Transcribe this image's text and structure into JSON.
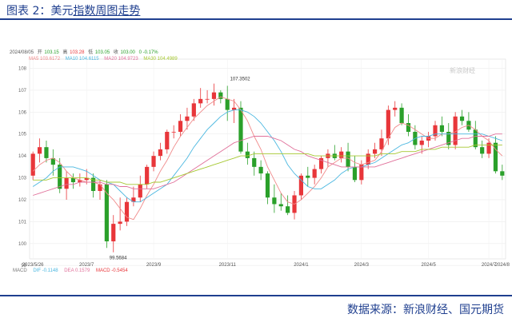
{
  "caption": {
    "prefix": "图表 2：美元",
    "underlined": "指数周图走势"
  },
  "source": "数据来源：新浪财经、国元期货",
  "info_line": {
    "date": "2024/08/05",
    "open_label": "开",
    "open": "103.15",
    "high_label": "高",
    "high": "103.28",
    "low_label": "低",
    "low": "103.05",
    "close_label": "收",
    "close": "103.00",
    "change": "0 -0.17%"
  },
  "ma_line": {
    "ma5": "MA5 103.6172",
    "ma10": "MA10 104.6115",
    "ma20": "MA20 104.9723",
    "ma30": "MA30 104.4989"
  },
  "macd_line": {
    "label": "MACD",
    "dif": "DIF -0.1148",
    "dea": "DEA 0.1579",
    "macd": "MACD -0.5454"
  },
  "watermark": "新浪财经",
  "colors": {
    "up": "#e8363a",
    "down": "#2aa02a",
    "ma5": "#f08a8a",
    "ma10": "#4ab7e0",
    "ma20": "#e0709a",
    "ma30": "#a6c832",
    "title": "#1f3f8f"
  },
  "chart_data": {
    "type": "candlestick",
    "title": "美元指数周图走势",
    "ylim": [
      99.3,
      108.2
    ],
    "y_ticks": [
      "108",
      "107",
      "106",
      "105",
      "104",
      "103",
      "102",
      "101",
      "100",
      "99"
    ],
    "x_ticks": [
      "2023/5/26",
      "2023/7",
      "2023/9",
      "2023/11",
      "2024/1",
      "2024/3",
      "2024/5",
      "2024/7",
      "2024/8"
    ],
    "annotations": [
      {
        "text": "107.3502",
        "value": 107.35,
        "candle": 30
      },
      {
        "text": "99.5684",
        "value": 99.57,
        "candle": 12
      }
    ],
    "candles": [
      {
        "o": 103.1,
        "h": 104.2,
        "l": 102.9,
        "c": 104.1
      },
      {
        "o": 104.1,
        "h": 104.8,
        "l": 103.7,
        "c": 104.4
      },
      {
        "o": 104.4,
        "h": 104.7,
        "l": 103.7,
        "c": 103.9
      },
      {
        "o": 103.9,
        "h": 104.3,
        "l": 103.1,
        "c": 103.6
      },
      {
        "o": 103.6,
        "h": 103.9,
        "l": 102.3,
        "c": 102.5
      },
      {
        "o": 102.5,
        "h": 103.3,
        "l": 102.0,
        "c": 103.0
      },
      {
        "o": 103.0,
        "h": 103.2,
        "l": 102.5,
        "c": 102.8
      },
      {
        "o": 102.8,
        "h": 103.2,
        "l": 102.6,
        "c": 102.9
      },
      {
        "o": 102.9,
        "h": 103.4,
        "l": 102.7,
        "c": 103.0
      },
      {
        "o": 103.0,
        "h": 103.2,
        "l": 102.1,
        "c": 102.4
      },
      {
        "o": 102.4,
        "h": 102.9,
        "l": 102.0,
        "c": 102.7
      },
      {
        "o": 102.7,
        "h": 102.9,
        "l": 99.8,
        "c": 100.1
      },
      {
        "o": 100.1,
        "h": 101.3,
        "l": 99.6,
        "c": 100.9
      },
      {
        "o": 100.9,
        "h": 102.1,
        "l": 100.6,
        "c": 101.0
      },
      {
        "o": 101.0,
        "h": 102.1,
        "l": 100.8,
        "c": 101.9
      },
      {
        "o": 101.9,
        "h": 102.6,
        "l": 101.7,
        "c": 102.1
      },
      {
        "o": 102.1,
        "h": 103.1,
        "l": 101.9,
        "c": 102.7
      },
      {
        "o": 102.7,
        "h": 103.6,
        "l": 102.5,
        "c": 103.5
      },
      {
        "o": 103.5,
        "h": 104.2,
        "l": 103.3,
        "c": 104.0
      },
      {
        "o": 104.0,
        "h": 104.6,
        "l": 103.8,
        "c": 104.3
      },
      {
        "o": 104.3,
        "h": 105.2,
        "l": 104.1,
        "c": 105.1
      },
      {
        "o": 105.1,
        "h": 105.4,
        "l": 104.8,
        "c": 105.1
      },
      {
        "o": 105.1,
        "h": 105.9,
        "l": 104.9,
        "c": 105.6
      },
      {
        "o": 105.6,
        "h": 106.2,
        "l": 105.2,
        "c": 105.8
      },
      {
        "o": 105.8,
        "h": 106.6,
        "l": 105.6,
        "c": 106.4
      },
      {
        "o": 106.4,
        "h": 107.1,
        "l": 106.2,
        "c": 106.6
      },
      {
        "o": 106.6,
        "h": 107.0,
        "l": 106.4,
        "c": 106.6
      },
      {
        "o": 106.6,
        "h": 107.3,
        "l": 106.3,
        "c": 106.9
      },
      {
        "o": 106.9,
        "h": 107.0,
        "l": 106.4,
        "c": 106.6
      },
      {
        "o": 106.6,
        "h": 107.2,
        "l": 105.6,
        "c": 106.1
      },
      {
        "o": 106.1,
        "h": 106.6,
        "l": 105.5,
        "c": 106.2
      },
      {
        "o": 106.2,
        "h": 106.5,
        "l": 104.1,
        "c": 104.2
      },
      {
        "o": 104.2,
        "h": 104.6,
        "l": 103.6,
        "c": 103.9
      },
      {
        "o": 103.9,
        "h": 104.2,
        "l": 103.1,
        "c": 103.5
      },
      {
        "o": 103.5,
        "h": 103.8,
        "l": 102.9,
        "c": 103.2
      },
      {
        "o": 103.2,
        "h": 103.3,
        "l": 101.8,
        "c": 102.1
      },
      {
        "o": 102.1,
        "h": 102.7,
        "l": 101.4,
        "c": 101.8
      },
      {
        "o": 101.8,
        "h": 102.3,
        "l": 101.5,
        "c": 101.7
      },
      {
        "o": 101.7,
        "h": 102.2,
        "l": 101.3,
        "c": 101.4
      },
      {
        "o": 101.4,
        "h": 102.4,
        "l": 101.1,
        "c": 102.2
      },
      {
        "o": 102.2,
        "h": 103.2,
        "l": 102.0,
        "c": 103.1
      },
      {
        "o": 103.1,
        "h": 103.5,
        "l": 102.6,
        "c": 103.0
      },
      {
        "o": 103.0,
        "h": 103.6,
        "l": 102.7,
        "c": 103.4
      },
      {
        "o": 103.4,
        "h": 104.0,
        "l": 103.2,
        "c": 103.9
      },
      {
        "o": 103.9,
        "h": 104.3,
        "l": 103.5,
        "c": 104.1
      },
      {
        "o": 104.1,
        "h": 104.5,
        "l": 103.8,
        "c": 103.9
      },
      {
        "o": 103.9,
        "h": 104.4,
        "l": 103.7,
        "c": 104.2
      },
      {
        "o": 104.2,
        "h": 104.6,
        "l": 103.3,
        "c": 103.5
      },
      {
        "o": 103.5,
        "h": 104.0,
        "l": 102.8,
        "c": 102.9
      },
      {
        "o": 102.9,
        "h": 103.8,
        "l": 102.7,
        "c": 103.6
      },
      {
        "o": 103.6,
        "h": 104.3,
        "l": 103.4,
        "c": 104.1
      },
      {
        "o": 104.1,
        "h": 104.6,
        "l": 103.9,
        "c": 104.3
      },
      {
        "o": 104.3,
        "h": 105.2,
        "l": 104.0,
        "c": 104.8
      },
      {
        "o": 104.8,
        "h": 106.3,
        "l": 104.5,
        "c": 106.1
      },
      {
        "o": 106.1,
        "h": 106.5,
        "l": 105.8,
        "c": 106.2
      },
      {
        "o": 106.2,
        "h": 106.4,
        "l": 105.4,
        "c": 105.5
      },
      {
        "o": 105.5,
        "h": 105.9,
        "l": 104.9,
        "c": 105.1
      },
      {
        "o": 105.1,
        "h": 105.4,
        "l": 104.3,
        "c": 104.5
      },
      {
        "o": 104.5,
        "h": 104.9,
        "l": 104.1,
        "c": 104.7
      },
      {
        "o": 104.7,
        "h": 105.1,
        "l": 104.4,
        "c": 104.9
      },
      {
        "o": 104.9,
        "h": 105.6,
        "l": 104.7,
        "c": 105.4
      },
      {
        "o": 105.4,
        "h": 105.8,
        "l": 104.9,
        "c": 105.1
      },
      {
        "o": 105.1,
        "h": 105.5,
        "l": 104.3,
        "c": 104.5
      },
      {
        "o": 104.5,
        "h": 106.0,
        "l": 104.3,
        "c": 105.8
      },
      {
        "o": 105.8,
        "h": 106.1,
        "l": 105.4,
        "c": 105.6
      },
      {
        "o": 105.6,
        "h": 106.0,
        "l": 105.1,
        "c": 105.2
      },
      {
        "o": 105.2,
        "h": 105.6,
        "l": 104.3,
        "c": 104.4
      },
      {
        "o": 104.4,
        "h": 104.7,
        "l": 103.9,
        "c": 104.1
      },
      {
        "o": 104.1,
        "h": 104.8,
        "l": 103.9,
        "c": 104.6
      },
      {
        "o": 104.6,
        "h": 104.9,
        "l": 103.2,
        "c": 103.3
      },
      {
        "o": 103.3,
        "h": 103.6,
        "l": 102.9,
        "c": 103.1
      }
    ],
    "series": [
      {
        "name": "MA5",
        "values": [
          103.3,
          103.6,
          103.8,
          103.9,
          103.7,
          103.3,
          103.0,
          102.9,
          102.8,
          102.8,
          102.7,
          102.3,
          102.0,
          101.6,
          101.2,
          101.1,
          101.6,
          102.2,
          102.7,
          103.3,
          103.8,
          104.4,
          104.9,
          105.3,
          105.7,
          106.0,
          106.3,
          106.5,
          106.7,
          106.6,
          106.5,
          106.1,
          105.6,
          104.9,
          104.3,
          103.5,
          102.9,
          102.3,
          101.9,
          101.8,
          102.0,
          102.3,
          102.6,
          103.0,
          103.5,
          103.7,
          103.9,
          103.9,
          103.7,
          103.6,
          103.7,
          103.8,
          104.2,
          104.8,
          105.3,
          105.5,
          105.4,
          105.2,
          105.0,
          104.8,
          104.8,
          105.0,
          105.0,
          105.1,
          105.3,
          105.4,
          105.2,
          104.9,
          104.7,
          104.3,
          104.0
        ]
      },
      {
        "name": "MA10",
        "values": [
          102.6,
          102.8,
          103.0,
          103.3,
          103.5,
          103.5,
          103.5,
          103.4,
          103.3,
          103.1,
          102.9,
          102.8,
          102.7,
          102.4,
          102.1,
          101.9,
          101.9,
          102.1,
          102.3,
          102.5,
          102.7,
          103.1,
          103.5,
          103.9,
          104.4,
          104.8,
          105.2,
          105.5,
          105.8,
          106.0,
          106.1,
          106.1,
          106.0,
          105.8,
          105.5,
          105.1,
          104.7,
          104.2,
          103.6,
          103.2,
          102.9,
          102.6,
          102.5,
          102.5,
          102.7,
          102.9,
          103.2,
          103.4,
          103.5,
          103.5,
          103.6,
          103.7,
          103.9,
          104.1,
          104.3,
          104.5,
          104.6,
          104.8,
          104.9,
          104.9,
          105.0,
          105.0,
          105.0,
          105.0,
          105.0,
          105.0,
          105.0,
          105.0,
          104.9,
          104.8,
          104.7
        ]
      },
      {
        "name": "MA20",
        "values": [
          102.2,
          102.3,
          102.4,
          102.5,
          102.6,
          102.7,
          102.7,
          102.8,
          102.8,
          102.8,
          102.8,
          102.7,
          102.7,
          102.6,
          102.6,
          102.5,
          102.5,
          102.5,
          102.5,
          102.6,
          102.7,
          102.8,
          103.0,
          103.2,
          103.4,
          103.6,
          103.8,
          104.0,
          104.2,
          104.4,
          104.6,
          104.7,
          104.8,
          104.9,
          104.9,
          104.9,
          104.8,
          104.7,
          104.5,
          104.3,
          104.2,
          104.0,
          103.9,
          103.8,
          103.7,
          103.6,
          103.5,
          103.5,
          103.5,
          103.5,
          103.5,
          103.5,
          103.6,
          103.7,
          103.8,
          103.9,
          104.0,
          104.1,
          104.2,
          104.3,
          104.4,
          104.5,
          104.6,
          104.7,
          104.8,
          104.8,
          104.9,
          104.9,
          104.9,
          105.0,
          105.0
        ]
      },
      {
        "name": "MA30",
        "values": [
          102.9,
          102.9,
          102.9,
          103.0,
          103.0,
          103.0,
          103.0,
          103.0,
          103.0,
          102.9,
          102.9,
          102.8,
          102.8,
          102.8,
          102.7,
          102.7,
          102.7,
          102.7,
          102.8,
          102.8,
          102.9,
          103.0,
          103.1,
          103.2,
          103.3,
          103.4,
          103.5,
          103.6,
          103.7,
          103.8,
          103.9,
          104.0,
          104.0,
          104.1,
          104.1,
          104.1,
          104.1,
          104.1,
          104.1,
          104.1,
          104.1,
          104.1,
          104.0,
          104.0,
          104.0,
          104.0,
          104.0,
          104.0,
          104.0,
          104.0,
          104.0,
          104.0,
          104.1,
          104.1,
          104.1,
          104.2,
          104.2,
          104.2,
          104.3,
          104.3,
          104.3,
          104.4,
          104.4,
          104.4,
          104.4,
          104.4,
          104.5,
          104.5,
          104.5,
          104.5,
          104.5
        ]
      }
    ]
  }
}
